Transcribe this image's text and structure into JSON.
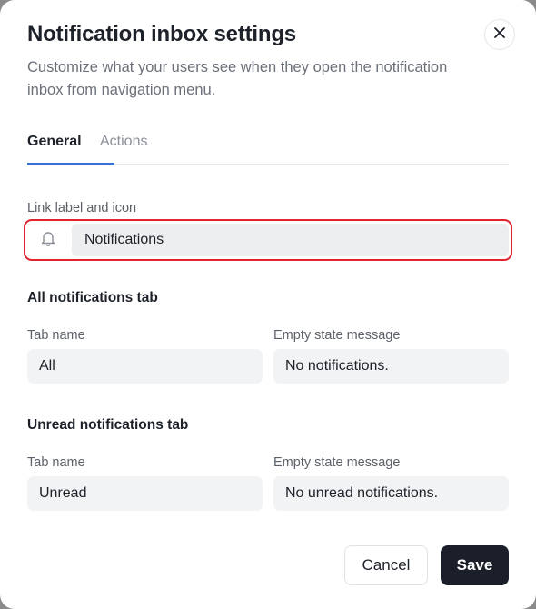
{
  "dialog": {
    "title": "Notification inbox settings",
    "subtitle": "Customize what your users see when they open the notification inbox from navigation menu.",
    "close_icon": "close-icon"
  },
  "tabs": [
    {
      "label": "General",
      "active": true
    },
    {
      "label": "Actions",
      "active": false
    }
  ],
  "link": {
    "label": "Link label and icon",
    "icon": "bell-icon",
    "value": "Notifications"
  },
  "all_tab": {
    "section_title": "All notifications tab",
    "tab_name_label": "Tab name",
    "tab_name_value": "All",
    "empty_label": "Empty state message",
    "empty_value": "No notifications."
  },
  "unread_tab": {
    "section_title": "Unread notifications tab",
    "tab_name_label": "Tab name",
    "tab_name_value": "Unread",
    "empty_label": "Empty state message",
    "empty_value": "No unread notifications."
  },
  "footer": {
    "cancel_label": "Cancel",
    "save_label": "Save"
  },
  "colors": {
    "accent": "#3b6fd4",
    "highlight_border": "#e0232e",
    "primary_button": "#1b1f2a"
  }
}
